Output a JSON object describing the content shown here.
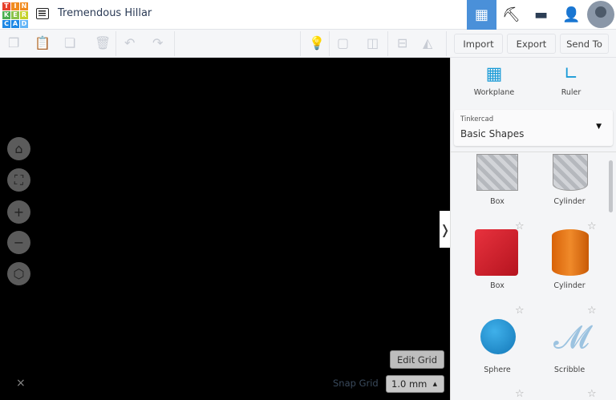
{
  "header": {
    "logo_letters": [
      "T",
      "I",
      "N",
      "K",
      "E",
      "R",
      "C",
      "A",
      "D"
    ],
    "title": "Tremendous Hillar"
  },
  "header_icons": [
    "grid-view-icon",
    "pickaxe-icon",
    "brick-icon",
    "add-user-icon",
    "avatar"
  ],
  "toolbar": {
    "import": "Import",
    "export": "Export",
    "send_to": "Send To"
  },
  "panel": {
    "workplane": "Workplane",
    "ruler": "Ruler",
    "library_source": "Tinkercad",
    "library_name": "Basic Shapes",
    "shapes": [
      {
        "label": "Box"
      },
      {
        "label": "Cylinder"
      },
      {
        "label": "Box"
      },
      {
        "label": "Cylinder"
      },
      {
        "label": "Sphere"
      },
      {
        "label": "Scribble"
      }
    ]
  },
  "viewport": {
    "edit_grid": "Edit Grid",
    "snap_grid_label": "Snap Grid",
    "snap_grid_value": "1.0 mm",
    "close": "×",
    "collapse": "❭"
  },
  "colors": {
    "accent": "#4a90d9",
    "box_red": "#d0202c",
    "cylinder_orange": "#e8730c",
    "sphere_blue": "#1a8fd0"
  }
}
